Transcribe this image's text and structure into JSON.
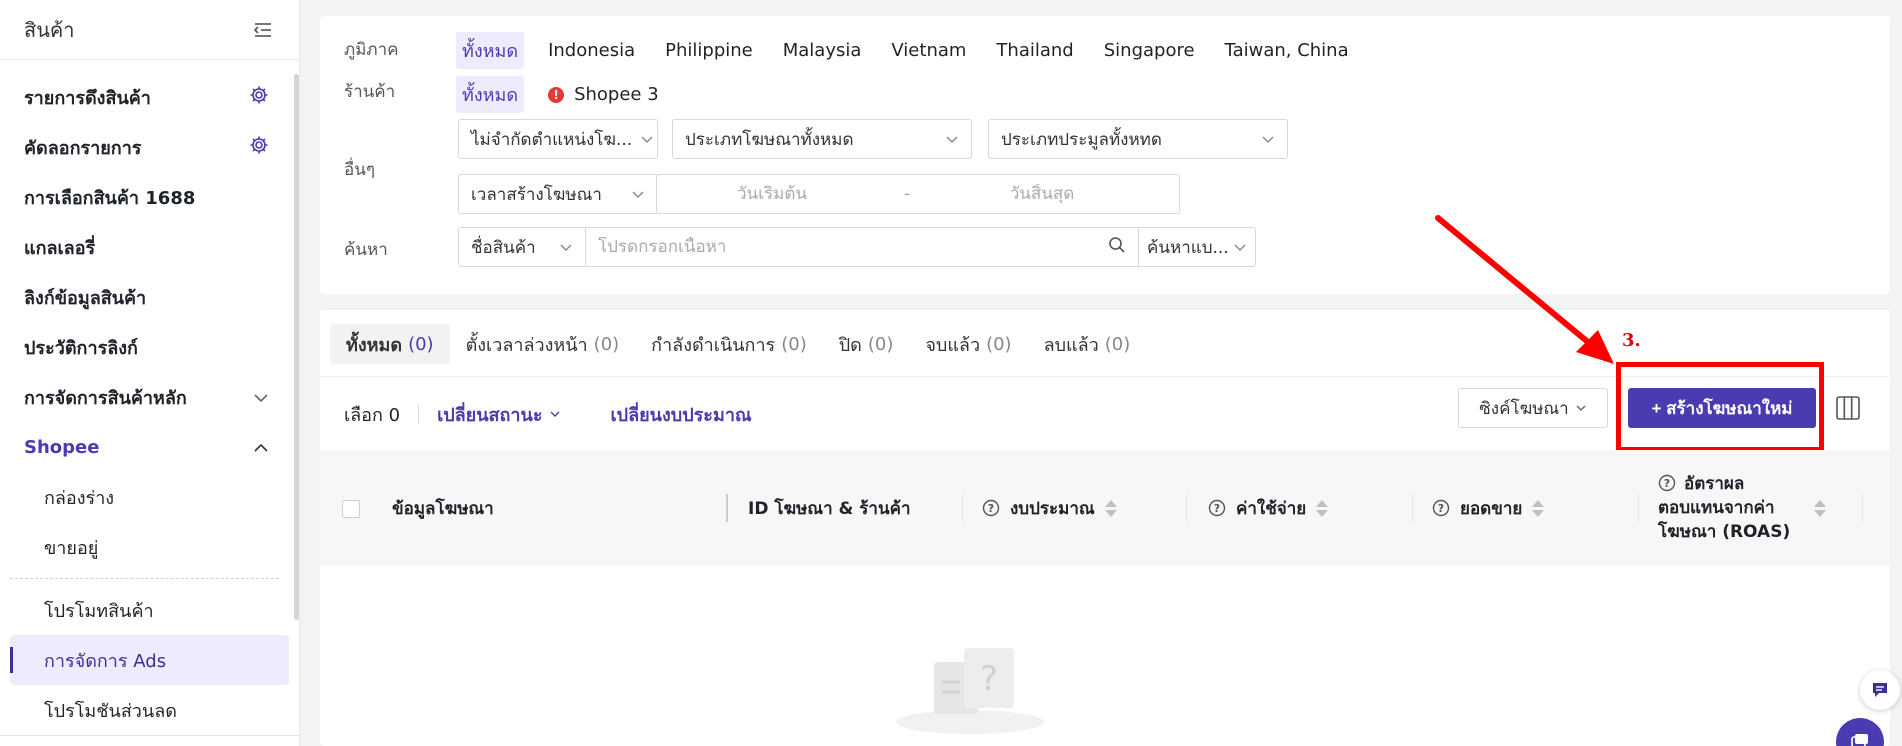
{
  "sidebar": {
    "title": "สินค้า",
    "items": [
      {
        "label": "รายการดึงสินค้า",
        "icon": "gear-icon"
      },
      {
        "label": "คัดลอกรายการ",
        "icon": "gear-icon"
      },
      {
        "label": "การเลือกสินค้า 1688"
      },
      {
        "label": "แกลเลอรี่"
      },
      {
        "label": "ลิงก์ข้อมูลสินค้า"
      },
      {
        "label": "ประวัติการลิงก์"
      },
      {
        "label": "การจัดการสินค้าหลัก",
        "icon": "chevron-down-icon"
      },
      {
        "label": "Shopee",
        "icon": "chevron-up-icon"
      }
    ],
    "shopee_sub": [
      "กล่องร่าง",
      "ขายอยู่"
    ],
    "sub_items": [
      "โปรโมทสินค้า",
      "การจัดการ Ads",
      "โปรโมชันส่วนลด"
    ]
  },
  "filters": {
    "region_label": "ภูมิภาค",
    "regions": [
      "ทั้งหมด",
      "Indonesia",
      "Philippine",
      "Malaysia",
      "Vietnam",
      "Thailand",
      "Singapore",
      "Taiwan, China"
    ],
    "shop_label": "ร้านค้า",
    "shop_all": "ทั้งหมด",
    "shop_name": "Shopee 3",
    "shop_warn": "!",
    "other_label": "อื่นๆ",
    "position_select": "ไม่จำกัดตำแหน่งโฆ...",
    "ad_type_select": "ประเภทโฆษณาทั้งหมด",
    "bid_type_select": "ประเภทประมูลทั้งหทด",
    "time_select": "เวลาสร้างโฆษณา",
    "start_placeholder": "วันเริ่มต้น",
    "date_sep": "-",
    "end_placeholder": "วันสิ้นสุด",
    "search_label": "ค้นหา",
    "search_field": "ชื่อสินค้า",
    "search_placeholder": "โปรดกรอกเนื้อหา",
    "search_mode": "ค้นหาแบ..."
  },
  "tabs": [
    {
      "label": "ทั้งหมด",
      "count": "(0)"
    },
    {
      "label": "ตั้งเวลาล่วงหน้า",
      "count": "(0)"
    },
    {
      "label": "กำลังดำเนินการ",
      "count": "(0)"
    },
    {
      "label": "ปิด",
      "count": "(0)"
    },
    {
      "label": "จบแล้ว",
      "count": "(0)"
    },
    {
      "label": "ลบแล้ว",
      "count": "(0)"
    }
  ],
  "toolbar": {
    "selected": "เลือก 0",
    "change_status": "เปลี่ยนสถานะ",
    "change_budget": "เปลี่ยนงบประมาณ",
    "sync": "ซิงค์โฆษณา",
    "create": "+ สร้างโฆษณาใหม่",
    "step": "3."
  },
  "columns": {
    "ad_info": "ข้อมูลโฆษณา",
    "ad_id_shop": "ID โฆษณา & ร้านค้า",
    "budget": "งบประมาณ",
    "cost": "ค่าใช้จ่าย",
    "sales": "ยอดขาย",
    "roas": "อัตราผลตอบแทนจากค่าโฆษณา (ROAS)"
  },
  "colors": {
    "accent": "#4b3bb0",
    "annotation": "#ff0000"
  }
}
